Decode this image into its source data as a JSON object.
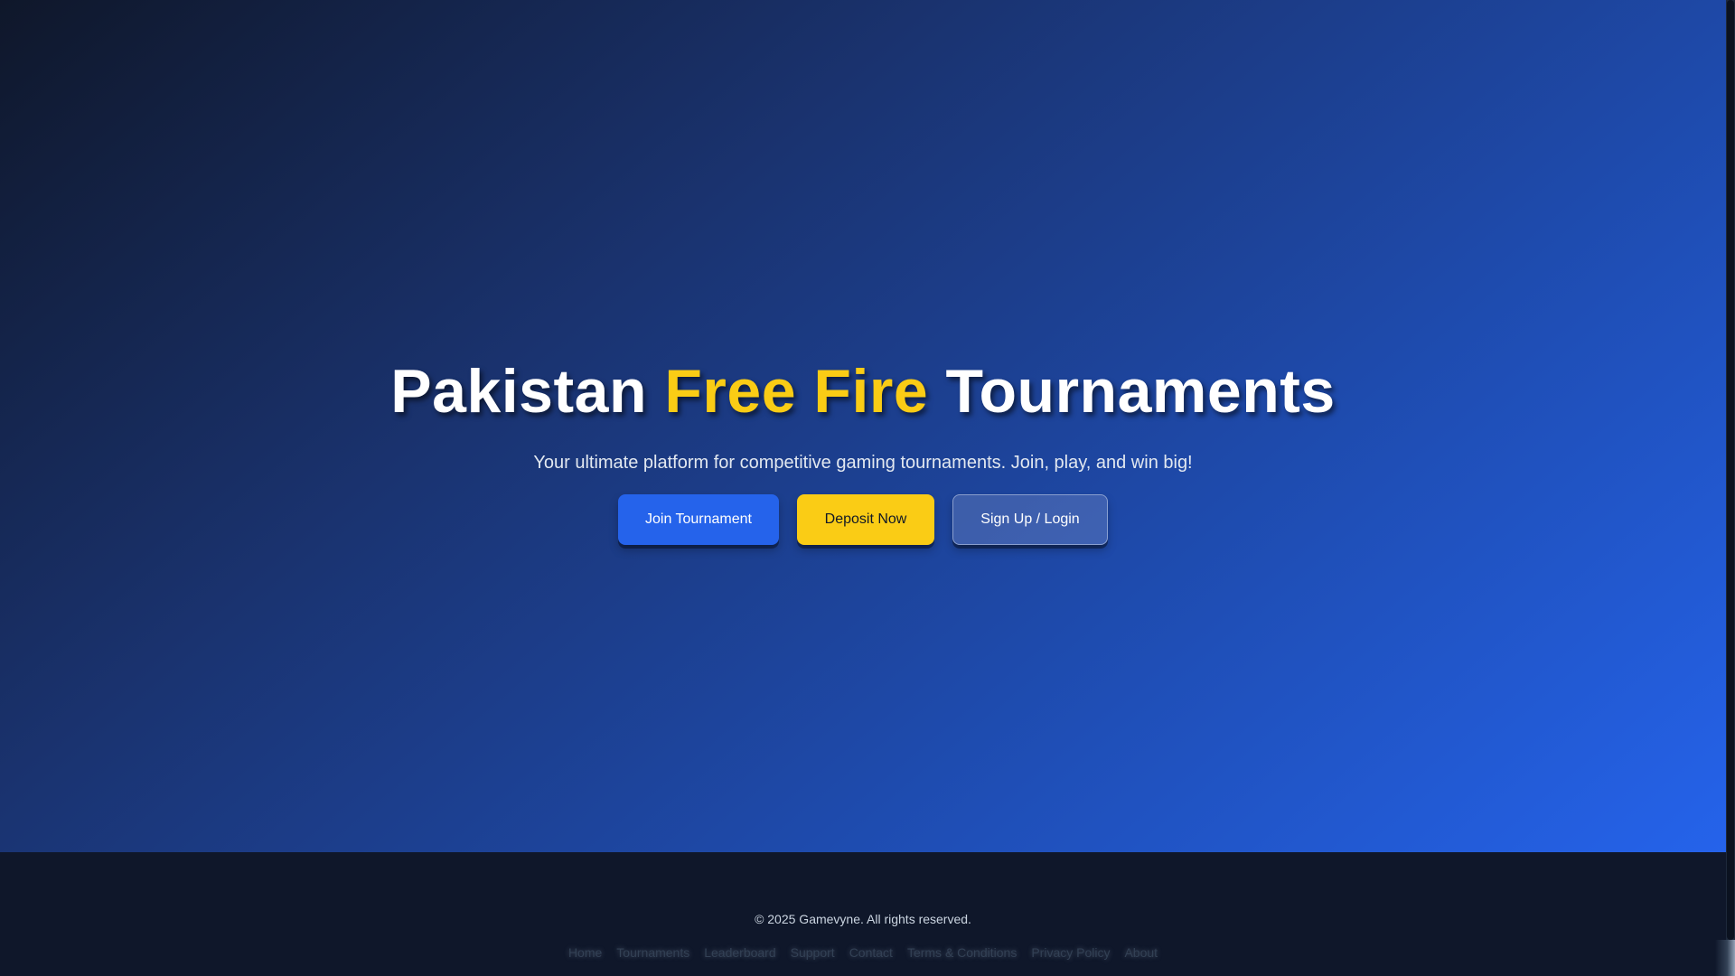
{
  "hero": {
    "title_part1": "Pakistan ",
    "title_accent": "Free Fire",
    "title_part2": " Tournaments",
    "subtitle": "Your ultimate platform for competitive gaming tournaments. Join, play, and win big!",
    "buttons": {
      "join": "Join Tournament",
      "deposit": "Deposit Now",
      "signup": "Sign Up / Login"
    }
  },
  "footer": {
    "copyright": "© 2025 Gamevyne. All rights reserved.",
    "links": [
      "Home",
      "Tournaments",
      "Leaderboard",
      "Support",
      "Contact",
      "Terms & Conditions",
      "Privacy Policy",
      "About"
    ]
  },
  "colors": {
    "accent_yellow": "#facc15",
    "primary_blue": "#2563eb",
    "footer_bg": "#0f172a"
  }
}
